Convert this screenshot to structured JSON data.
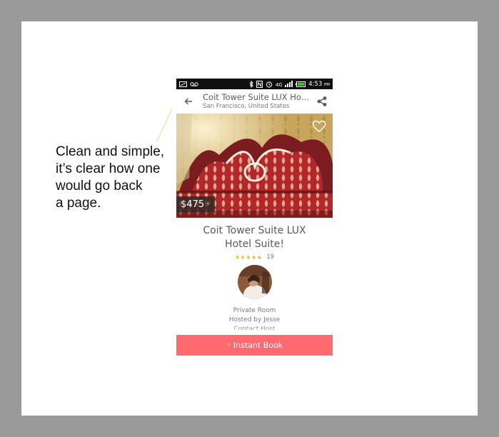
{
  "annotation": {
    "lines": [
      "Clean and simple,",
      "it’s clear how one",
      "would go back",
      "a page."
    ]
  },
  "status_bar": {
    "time": "4:53",
    "ampm": "PM",
    "icons": [
      "message-icon",
      "voicemail-icon",
      "bluetooth-icon",
      "nfc-icon",
      "alarm-icon",
      "4g-icon",
      "signal-icon",
      "battery-icon"
    ]
  },
  "header": {
    "title": "Coit Tower Suite LUX Hot…",
    "subtitle": "San Francisco, United States"
  },
  "listing": {
    "price": "$475",
    "title": "Coit Tower Suite LUX Hotel Suite!",
    "rating_stars": "★★★★★",
    "rating_value": 4.5,
    "review_count": "19",
    "room_type": "Private Room",
    "hosted_by": "Hosted by Jesse",
    "contact_host": "Contact Host"
  },
  "cta": {
    "label": "Instant Book"
  },
  "colors": {
    "background": "#9a9a9a",
    "accent": "#ff6a70",
    "star": "#ffb400",
    "text": "#565a5c"
  }
}
